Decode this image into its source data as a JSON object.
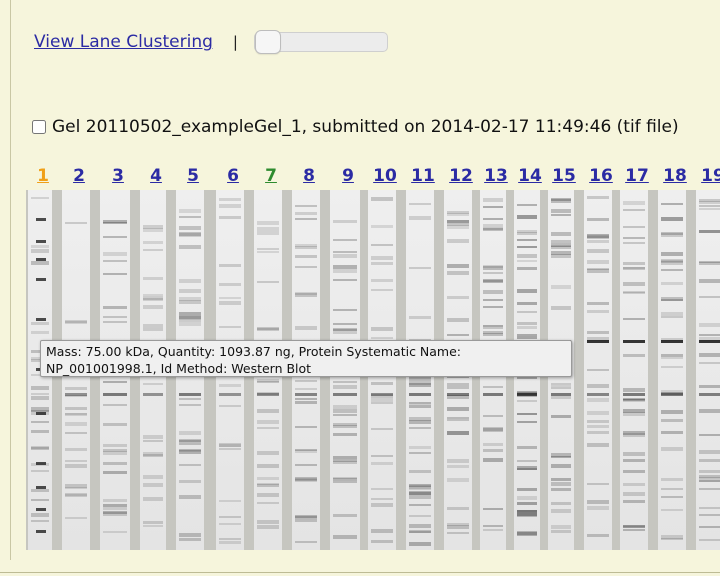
{
  "toolbar": {
    "view_lane_clustering": "View Lane Clustering",
    "separator": "|",
    "slider_value": 0
  },
  "gel": {
    "title": "Gel 20110502_exampleGel_1, submitted on 2014-02-17 11:49:46 (tif file)",
    "checkbox_checked": false
  },
  "lanes": [
    {
      "label": "1",
      "color": "#f0a018"
    },
    {
      "label": "2",
      "color": "#2b2ba4"
    },
    {
      "label": "3",
      "color": "#2b2ba4"
    },
    {
      "label": "4",
      "color": "#2b2ba4"
    },
    {
      "label": "5",
      "color": "#2b2ba4"
    },
    {
      "label": "6",
      "color": "#2b2ba4"
    },
    {
      "label": "7",
      "color": "#2e8b2e"
    },
    {
      "label": "8",
      "color": "#2b2ba4"
    },
    {
      "label": "9",
      "color": "#2b2ba4"
    },
    {
      "label": "10",
      "color": "#2b2ba4"
    },
    {
      "label": "11",
      "color": "#2b2ba4"
    },
    {
      "label": "12",
      "color": "#2b2ba4"
    },
    {
      "label": "13",
      "color": "#2b2ba4"
    },
    {
      "label": "14",
      "color": "#2b2ba4"
    },
    {
      "label": "15",
      "color": "#2b2ba4"
    },
    {
      "label": "16",
      "color": "#2b2ba4"
    },
    {
      "label": "17",
      "color": "#2b2ba4"
    },
    {
      "label": "18",
      "color": "#2b2ba4"
    },
    {
      "label": "19",
      "color": "#2b2ba4"
    }
  ],
  "tooltip": {
    "line1": "Mass: 75.00 kDa, Quantity: 1093.87 ng, Protein Systematic Name:",
    "line2": "NP_001001998.1, Id Method: Western Blot"
  }
}
